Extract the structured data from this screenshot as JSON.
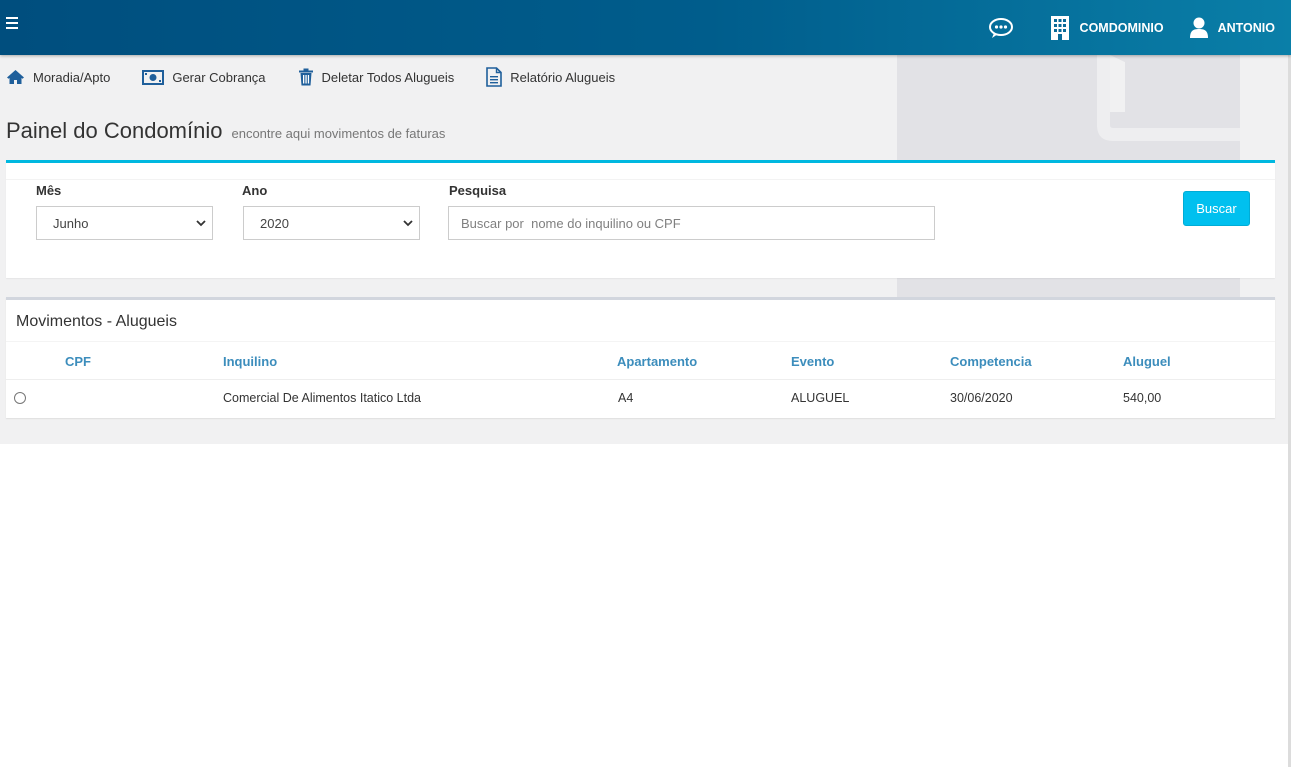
{
  "header": {
    "menu_icon": "hamburger-icon",
    "items": [
      {
        "icon": "chat-icon",
        "label": ""
      },
      {
        "icon": "building-icon",
        "label": "COMDOMINIO"
      },
      {
        "icon": "user-icon",
        "label": "ANTONIO"
      }
    ]
  },
  "actions": [
    {
      "icon": "home-icon",
      "label": "Moradia/Apto"
    },
    {
      "icon": "money-icon",
      "label": "Gerar Cobrança"
    },
    {
      "icon": "trash-icon",
      "label": "Deletar Todos Alugueis"
    },
    {
      "icon": "document-icon",
      "label": "Relatório Alugueis"
    }
  ],
  "page": {
    "title": "Painel do Condomínio",
    "subtitle": "encontre aqui movimentos de faturas"
  },
  "filters": {
    "month_label": "Mês",
    "month_value": "Junho",
    "year_label": "Ano",
    "year_value": "2020",
    "search_label": "Pesquisa",
    "search_placeholder": "Buscar por  nome do inquilino ou CPF",
    "search_value": "",
    "button_label": "Buscar"
  },
  "table": {
    "title": "Movimentos - Alugueis",
    "columns": [
      "CPF",
      "Inquilino",
      "Apartamento",
      "Evento",
      "Competencia",
      "Aluguel"
    ],
    "rows": [
      {
        "cpf": "",
        "inquilino": "Comercial De Alimentos Itatico Ltda",
        "apartamento": "A4",
        "evento": "ALUGUEL",
        "competencia": "30/06/2020",
        "aluguel": "540,00"
      }
    ]
  },
  "colors": {
    "header_gradient_start": "#004e7e",
    "header_gradient_end": "#0a7fa8",
    "accent": "#00c0ef",
    "column_header": "#3c8dbc",
    "icon_blue": "#1f5f9b"
  }
}
